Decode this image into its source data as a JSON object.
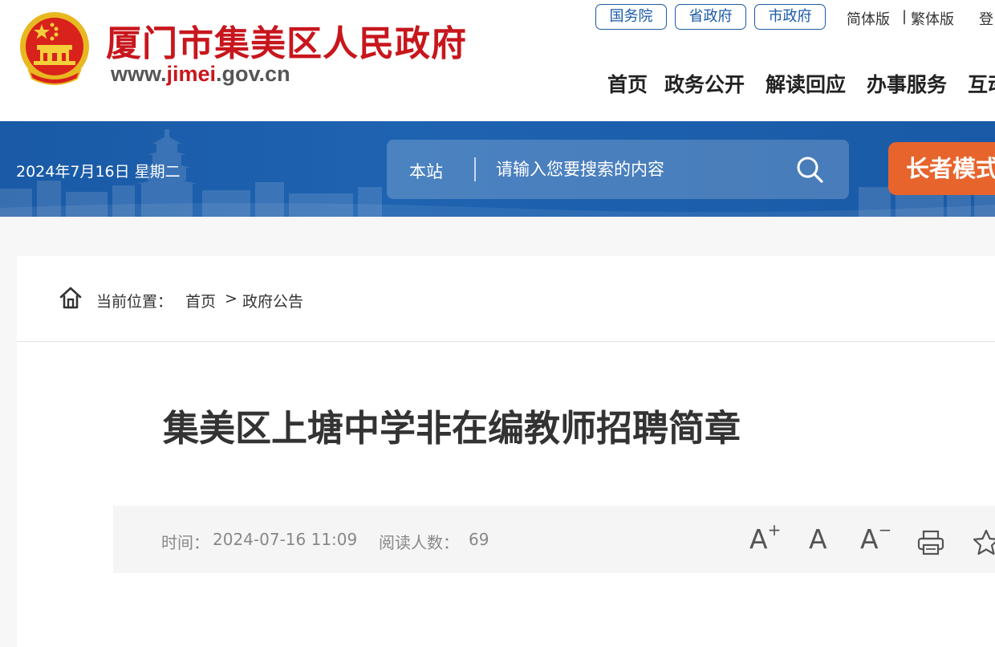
{
  "header": {
    "site_name": "厦门市集美区人民政府",
    "site_url": {
      "prefix": "www.",
      "highlight": "jimei",
      "suffix": ".gov.cn"
    },
    "top_links": [
      "国务院",
      "省政府",
      "市政府"
    ],
    "lang": {
      "simplified": "简体版",
      "separator": "|",
      "traditional": "繁体版",
      "login": "登"
    },
    "nav": [
      "首页",
      "政务公开",
      "解读回应",
      "办事服务",
      "互动"
    ]
  },
  "banner": {
    "date": "2024年7月16日 星期二",
    "search": {
      "scope": "本站",
      "placeholder": "请输入您要搜索的内容"
    },
    "elder_mode": "长者模式"
  },
  "breadcrumb": {
    "label": "当前位置：",
    "items": [
      "首页",
      "政府公告"
    ],
    "separator": ">"
  },
  "article": {
    "title": "集美区上塘中学非在编教师招聘简章",
    "time_label": "时间：",
    "time": "2024-07-16 11:09",
    "reads_label": "阅读人数：",
    "reads": "69",
    "tools": {
      "font_up": "A",
      "font_normal": "A",
      "font_down": "A"
    }
  },
  "colors": {
    "brand_red": "#c8161d",
    "banner_blue": "#1a5aa6",
    "elder_orange": "#e7642d"
  }
}
